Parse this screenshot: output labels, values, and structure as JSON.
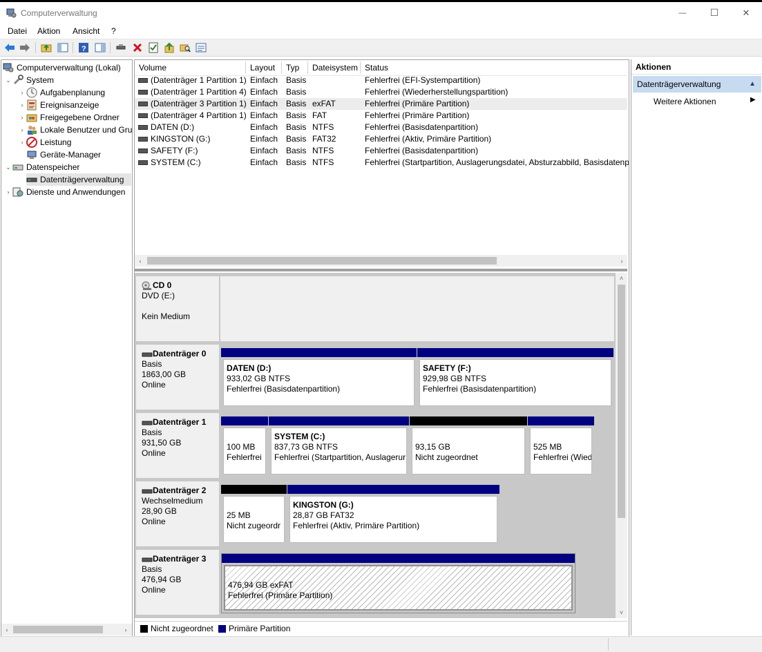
{
  "window": {
    "title": "Computerverwaltung",
    "minimize": "—",
    "maximize": "☐",
    "close": "✕"
  },
  "menu": [
    "Datei",
    "Aktion",
    "Ansicht",
    "?"
  ],
  "tree": {
    "root": "Computerverwaltung (Lokal)",
    "system": "System",
    "system_items": [
      "Aufgabenplanung",
      "Ereignisanzeige",
      "Freigegebene Ordner",
      "Lokale Benutzer und Gruppen",
      "Leistung",
      "Geräte-Manager"
    ],
    "storage": "Datenspeicher",
    "disk_mgmt": "Datenträgerverwaltung",
    "services": "Dienste und Anwendungen"
  },
  "table": {
    "headers": [
      "Volume",
      "Layout",
      "Typ",
      "Dateisystem",
      "Status"
    ],
    "rows": [
      [
        "(Datenträger 1 Partition 1)",
        "Einfach",
        "Basis",
        "",
        "Fehlerfrei (EFI-Systempartition)"
      ],
      [
        "(Datenträger 1 Partition 4)",
        "Einfach",
        "Basis",
        "",
        "Fehlerfrei (Wiederherstellungspartition)"
      ],
      [
        "(Datenträger 3 Partition 1)",
        "Einfach",
        "Basis",
        "exFAT",
        "Fehlerfrei (Primäre Partition)"
      ],
      [
        "(Datenträger 4 Partition 1)",
        "Einfach",
        "Basis",
        "FAT",
        "Fehlerfrei (Primäre Partition)"
      ],
      [
        "DATEN (D:)",
        "Einfach",
        "Basis",
        "NTFS",
        "Fehlerfrei (Basisdatenpartition)"
      ],
      [
        "KINGSTON (G:)",
        "Einfach",
        "Basis",
        "FAT32",
        "Fehlerfrei (Aktiv, Primäre Partition)"
      ],
      [
        "SAFETY (F:)",
        "Einfach",
        "Basis",
        "NTFS",
        "Fehlerfrei (Basisdatenpartition)"
      ],
      [
        "SYSTEM (C:)",
        "Einfach",
        "Basis",
        "NTFS",
        "Fehlerfrei (Startpartition, Auslagerungsdatei, Absturzabbild, Basisdatenpartition)"
      ]
    ]
  },
  "disks": {
    "cd0": {
      "name": "CD 0",
      "type": "DVD (E:)",
      "status": "Kein Medium"
    },
    "d0": {
      "name": "Datenträger 0",
      "type": "Basis",
      "size": "1863,00 GB",
      "state": "Online",
      "p1": {
        "name": "DATEN  (D:)",
        "size": "933,02 GB NTFS",
        "status": "Fehlerfrei (Basisdatenpartition)"
      },
      "p2": {
        "name": "SAFETY  (F:)",
        "size": "929,98 GB NTFS",
        "status": "Fehlerfrei (Basisdatenpartition)"
      }
    },
    "d1": {
      "name": "Datenträger 1",
      "type": "Basis",
      "size": "931,50 GB",
      "state": "Online",
      "p1": {
        "size": "100 MB",
        "status": "Fehlerfrei"
      },
      "p2": {
        "name": "SYSTEM  (C:)",
        "size": "837,73 GB NTFS",
        "status": "Fehlerfrei (Startpartition, Auslagerur"
      },
      "p3": {
        "size": "93,15 GB",
        "status": "Nicht zugeordnet"
      },
      "p4": {
        "size": "525 MB",
        "status": "Fehlerfrei (Wied"
      }
    },
    "d2": {
      "name": "Datenträger 2",
      "type": "Wechselmedium",
      "size": "28,90 GB",
      "state": "Online",
      "p1": {
        "size": "25 MB",
        "status": "Nicht zugeordr"
      },
      "p2": {
        "name": "KINGSTON  (G:)",
        "size": "28,87 GB FAT32",
        "status": "Fehlerfrei (Aktiv, Primäre Partition)"
      }
    },
    "d3": {
      "name": "Datenträger 3",
      "type": "Basis",
      "size": "476,94 GB",
      "state": "Online",
      "p1": {
        "size": "476,94 GB exFAT",
        "status": "Fehlerfrei (Primäre Partition)"
      }
    }
  },
  "legend": {
    "unallocated": "Nicht zugeordnet",
    "primary": "Primäre Partition"
  },
  "actions": {
    "title": "Aktionen",
    "section": "Datenträgerverwaltung",
    "more": "Weitere Aktionen"
  },
  "colors": {
    "primary": "#000080",
    "unallocated": "#000000",
    "selection": "#c7dbf0"
  }
}
